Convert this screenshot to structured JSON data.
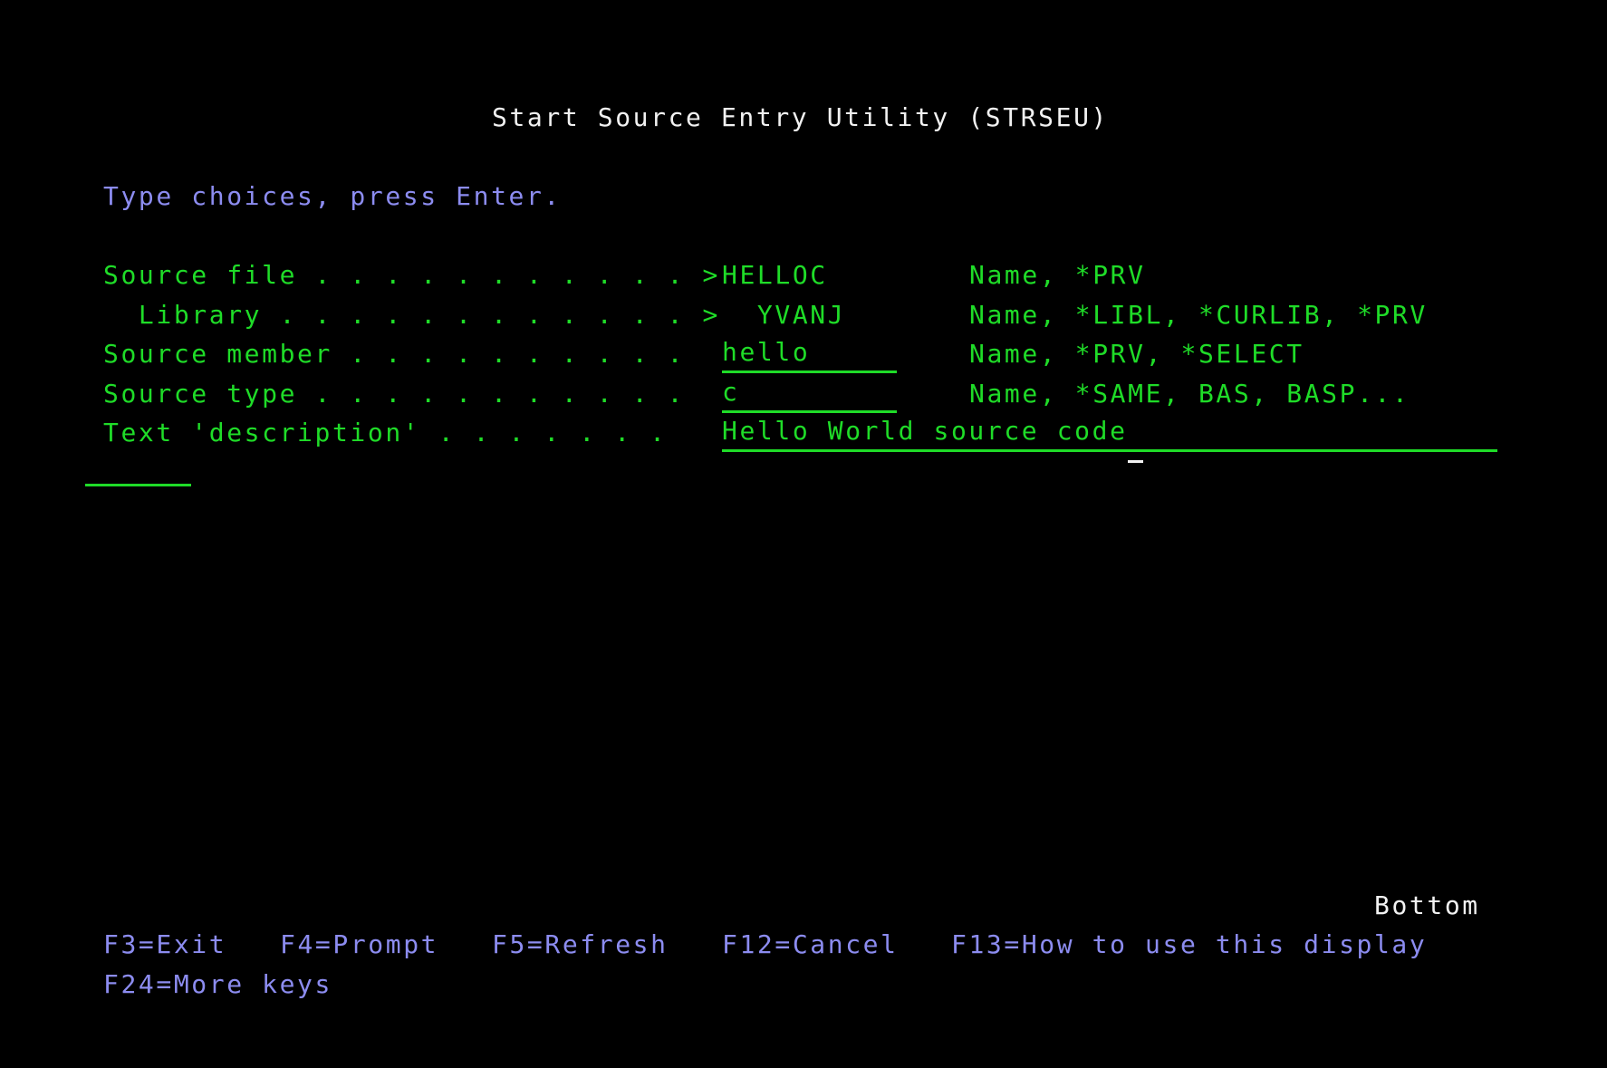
{
  "title": "Start Source Entry Utility (STRSEU)",
  "instruction": "Type choices, press Enter.",
  "fields": [
    {
      "label": "Source file . . . . . . . . . . . >",
      "value": "HELLOC",
      "hint": "Name, *PRV"
    },
    {
      "label": "  Library . . . . . . . . . . . . >",
      "value": "  YVANJ",
      "hint": "Name, *LIBL, *CURLIB, *PRV"
    },
    {
      "label": "Source member . . . . . . . . . .",
      "value": "hello",
      "hint": "Name, *PRV, *SELECT"
    },
    {
      "label": "Source type . . . . . . . . . . .",
      "value": "c",
      "hint": "Name, *SAME, BAS, BASP..."
    },
    {
      "label": "Text 'description' . . . . . . .",
      "value": "Hello World source code",
      "hint": ""
    }
  ],
  "status": "Bottom",
  "function_keys": [
    "F3=Exit",
    "F4=Prompt",
    "F5=Refresh",
    "F12=Cancel",
    "F13=How to use this display",
    "F24=More keys"
  ],
  "colors": {
    "background": "#000000",
    "title": "#f2f2f2",
    "instruction": "#8c8cf0",
    "field": "#1fdc28"
  }
}
